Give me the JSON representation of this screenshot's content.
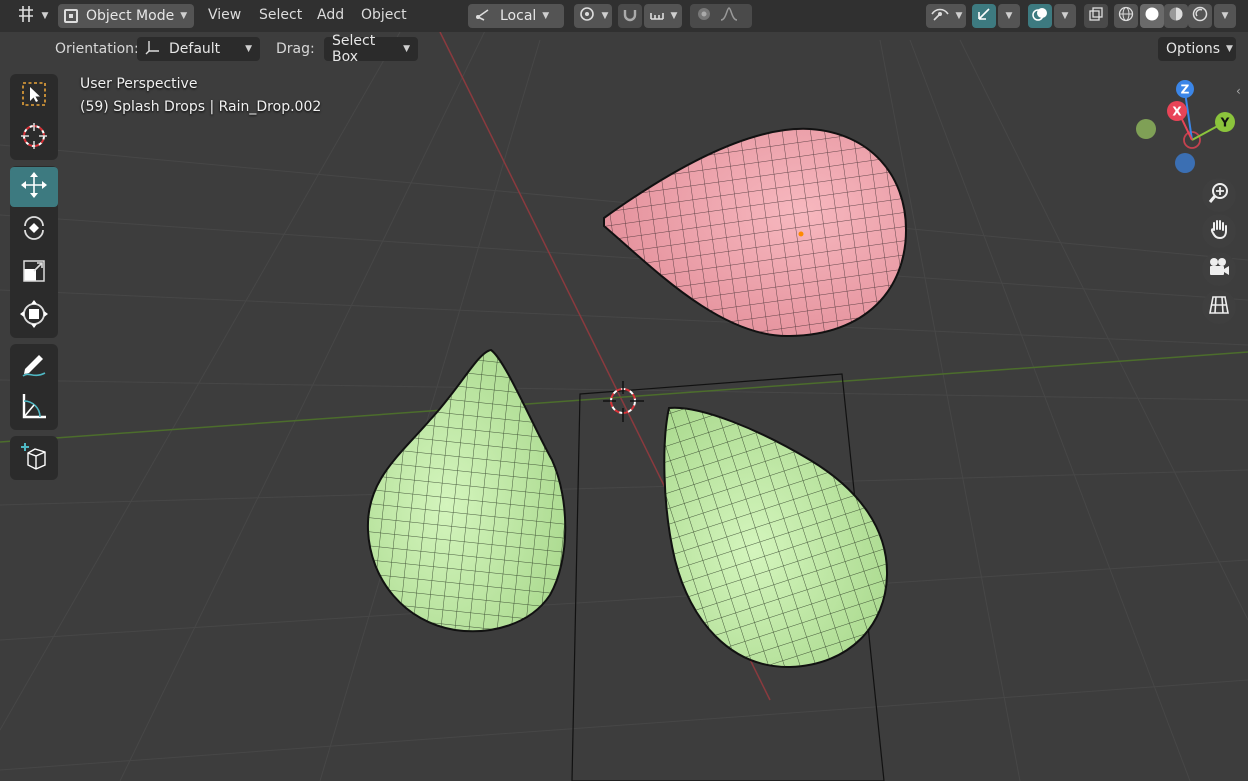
{
  "header": {
    "editor_type_icon": "grid-icon",
    "mode": {
      "label": "Object Mode",
      "icon": "object-mode-icon"
    },
    "menus": [
      "View",
      "Select",
      "Add",
      "Object"
    ],
    "transform_orientation": {
      "label": "Local",
      "icon": "transform-orientation-icon"
    },
    "pivot_icon": "pivot-point-icon",
    "snap_icon": "snap-magnet-icon",
    "snap_target_icon": "snap-increment-icon",
    "proportional_icon": "proportional-edit-icon",
    "falloff_icon": "falloff-curve-icon",
    "visibility_icon": "object-visibility-icon",
    "gizmo_icon": "gizmo-icon",
    "overlay_icon": "overlay-icon",
    "xray_icon": "xray-icon",
    "shading_modes": [
      "wireframe",
      "solid",
      "material-preview",
      "rendered"
    ],
    "active_shading": "solid"
  },
  "tool_settings": {
    "orientation_label": "Orientation:",
    "orientation_value": "Default",
    "drag_label": "Drag:",
    "drag_value": "Select Box",
    "options_label": "Options"
  },
  "overlay": {
    "view_name": "User Perspective",
    "object_info": "(59) Splash Drops | Rain_Drop.002"
  },
  "toolbar": {
    "tools": [
      "select-box",
      "cursor",
      "move",
      "rotate",
      "scale",
      "transform",
      "annotate",
      "measure",
      "add-cube"
    ],
    "active_tool": "move"
  },
  "navigation_gizmo": {
    "axes": [
      "X",
      "Y",
      "Z"
    ],
    "colors": {
      "x": "#e84457",
      "y": "#8bc43c",
      "z": "#3b86e8"
    }
  },
  "navigation_buttons": [
    "zoom-icon",
    "pan-hand-icon",
    "camera-view-icon",
    "ortho-grid-icon"
  ],
  "scene": {
    "objects": [
      {
        "name": "pink-raindrop",
        "color": "#f2a5ad",
        "selected": true
      },
      {
        "name": "green-raindrop-left",
        "color": "#c3eda8",
        "selected": false
      },
      {
        "name": "green-raindrop-right",
        "color": "#c3eda8",
        "selected": false
      }
    ],
    "colors": {
      "background": "#3d3d3d",
      "grid": "#474747",
      "x_axis": "#8a3a3e",
      "y_axis": "#4c6d2c",
      "accent": "#3d7a80"
    }
  }
}
